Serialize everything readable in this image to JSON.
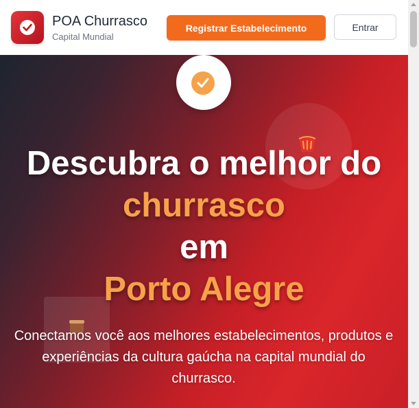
{
  "header": {
    "brand_name": "POA Churrasco",
    "brand_subtitle": "Capital Mundial",
    "register_label": "Registrar Estabelecimento",
    "login_label": "Entrar"
  },
  "hero": {
    "title_line1": "Descubra o melhor do",
    "title_line2": "churrasco",
    "title_line3": "em",
    "title_line4": "Porto Alegre",
    "subtitle": "Conectamos você aos melhores estabelecimentos, produtos e experiências da cultura gaúcha na capital mundial do churrasco."
  },
  "icons": {
    "logo": "check-circle-icon",
    "hero_badge": "check-circle-icon",
    "decor_1": "bucket-icon",
    "decor_2": "pot-icon"
  },
  "colors": {
    "brand_red": "#d9262b",
    "accent_orange": "#f26b1d",
    "highlight": "#f6a24b",
    "hero_dark": "#1e2430"
  }
}
